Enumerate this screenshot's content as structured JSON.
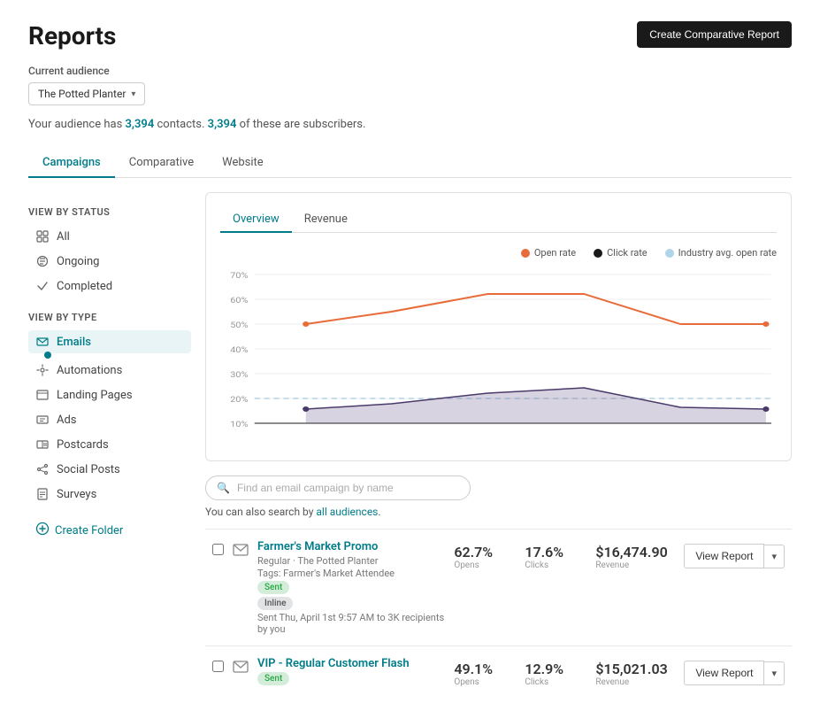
{
  "page": {
    "title": "Reports",
    "create_report_btn": "Create Comparative Report"
  },
  "audience": {
    "label": "Current audience",
    "name": "The Potted Planter",
    "info_prefix": "Your audience has ",
    "contacts": "3,394",
    "info_middle": " contacts. ",
    "subscribers": "3,394",
    "info_suffix": " of these are subscribers."
  },
  "tabs": [
    {
      "label": "Campaigns",
      "active": true
    },
    {
      "label": "Comparative",
      "active": false
    },
    {
      "label": "Website",
      "active": false
    }
  ],
  "sidebar": {
    "view_by_status_title": "View by Status",
    "status_items": [
      {
        "label": "All",
        "icon": "grid-icon",
        "active": false
      },
      {
        "label": "Ongoing",
        "icon": "ongoing-icon",
        "active": false
      },
      {
        "label": "Completed",
        "icon": "completed-icon",
        "active": false
      }
    ],
    "view_by_type_title": "View by Type",
    "type_items": [
      {
        "label": "Emails",
        "icon": "email-icon",
        "active": true
      },
      {
        "label": "Automations",
        "icon": "automation-icon",
        "active": false
      },
      {
        "label": "Landing Pages",
        "icon": "landing-icon",
        "active": false
      },
      {
        "label": "Ads",
        "icon": "ads-icon",
        "active": false
      },
      {
        "label": "Postcards",
        "icon": "postcard-icon",
        "active": false
      },
      {
        "label": "Social Posts",
        "icon": "social-icon",
        "active": false
      },
      {
        "label": "Surveys",
        "icon": "survey-icon",
        "active": false
      }
    ],
    "create_folder": "Create Folder"
  },
  "chart": {
    "tabs": [
      {
        "label": "Overview",
        "active": true
      },
      {
        "label": "Revenue",
        "active": false
      }
    ],
    "legend": [
      {
        "label": "Open rate",
        "color": "orange"
      },
      {
        "label": "Click rate",
        "color": "dark"
      },
      {
        "label": "Industry avg. open rate",
        "color": "blue"
      }
    ],
    "y_labels": [
      "70%",
      "60%",
      "50%",
      "40%",
      "30%",
      "20%",
      "10%"
    ]
  },
  "search": {
    "placeholder": "Find an email campaign by name",
    "hint_prefix": "You can also search by ",
    "hint_link": "all audiences",
    "hint_suffix": "."
  },
  "campaigns": [
    {
      "name": "Farmer's Market Promo",
      "type": "Regular",
      "audience": "The Potted Planter",
      "tags": "Tags: Farmer's Market Attendee",
      "sent_info": "Sent Thu, April 1st 9:57 AM to 3K recipients by you",
      "badges": [
        "Sent",
        "Inline"
      ],
      "opens": "62.7%",
      "clicks": "17.6%",
      "revenue": "$16,474.90",
      "opens_label": "Opens",
      "clicks_label": "Clicks",
      "revenue_label": "Revenue",
      "btn": "View Report"
    },
    {
      "name": "VIP - Regular Customer Flash",
      "type": "",
      "audience": "",
      "tags": "",
      "sent_info": "",
      "badges": [
        "Sent"
      ],
      "opens": "49.1%",
      "clicks": "12.9%",
      "revenue": "$15,021.03",
      "opens_label": "Opens",
      "clicks_label": "Clicks",
      "revenue_label": "Revenue",
      "btn": "View Report"
    }
  ]
}
